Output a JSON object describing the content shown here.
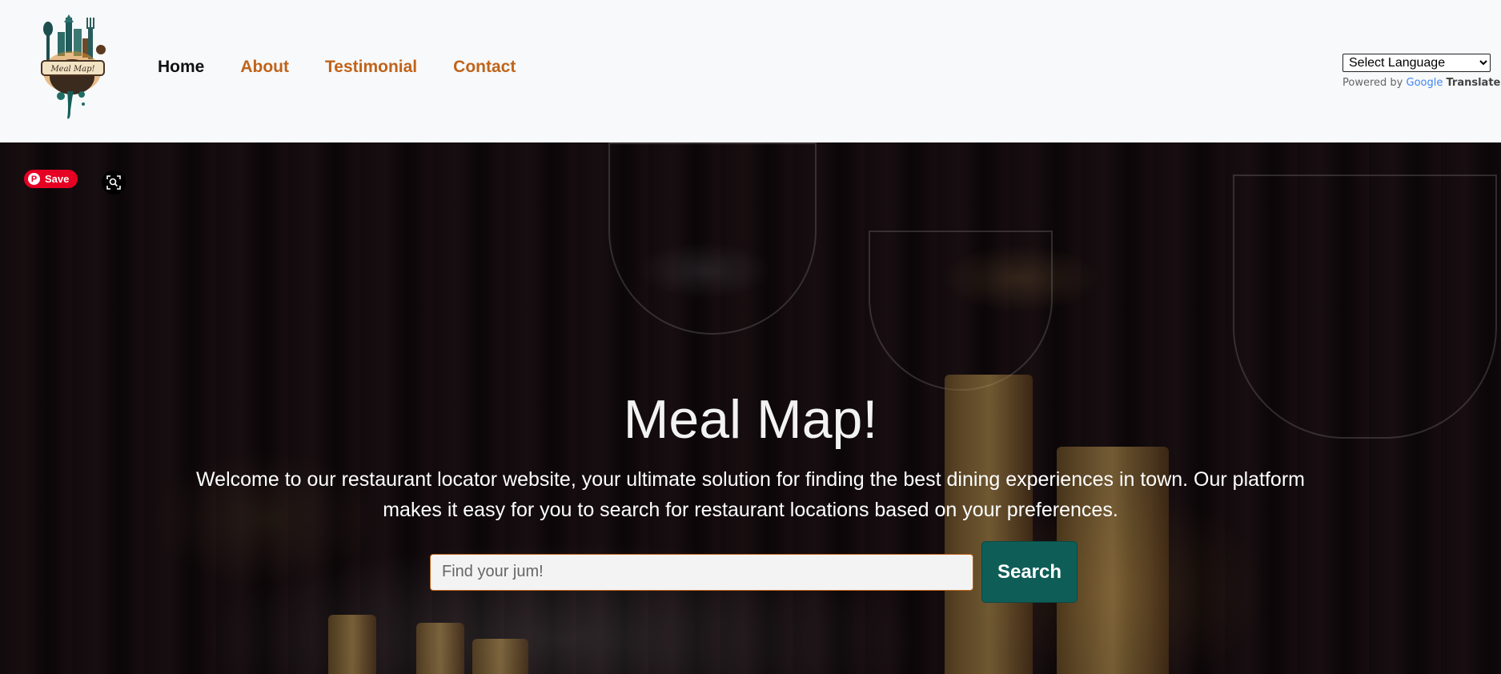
{
  "header": {
    "logo_text": "Meal Map!",
    "nav": [
      {
        "label": "Home",
        "active": true
      },
      {
        "label": "About"
      },
      {
        "label": "Testimonial"
      },
      {
        "label": "Contact"
      }
    ],
    "translate": {
      "select_value": "Select Language",
      "powered_by": "Powered by",
      "google": "Google",
      "translate_label": "Translate"
    }
  },
  "hero": {
    "pin_save_label": "Save",
    "title": "Meal Map!",
    "description": "Welcome to our restaurant locator website, your ultimate solution for finding the best dining experiences in town. Our platform makes it easy for you to search for restaurant locations based on your preferences.",
    "search": {
      "placeholder": "Find your jum!",
      "value": "",
      "button_label": "Search"
    }
  },
  "colors": {
    "accent_orange": "#c0631a",
    "search_button": "#0e5e57",
    "pinterest_red": "#e60023"
  },
  "icons": [
    "meal-map-logo",
    "pinterest-icon",
    "lens-search-icon"
  ]
}
